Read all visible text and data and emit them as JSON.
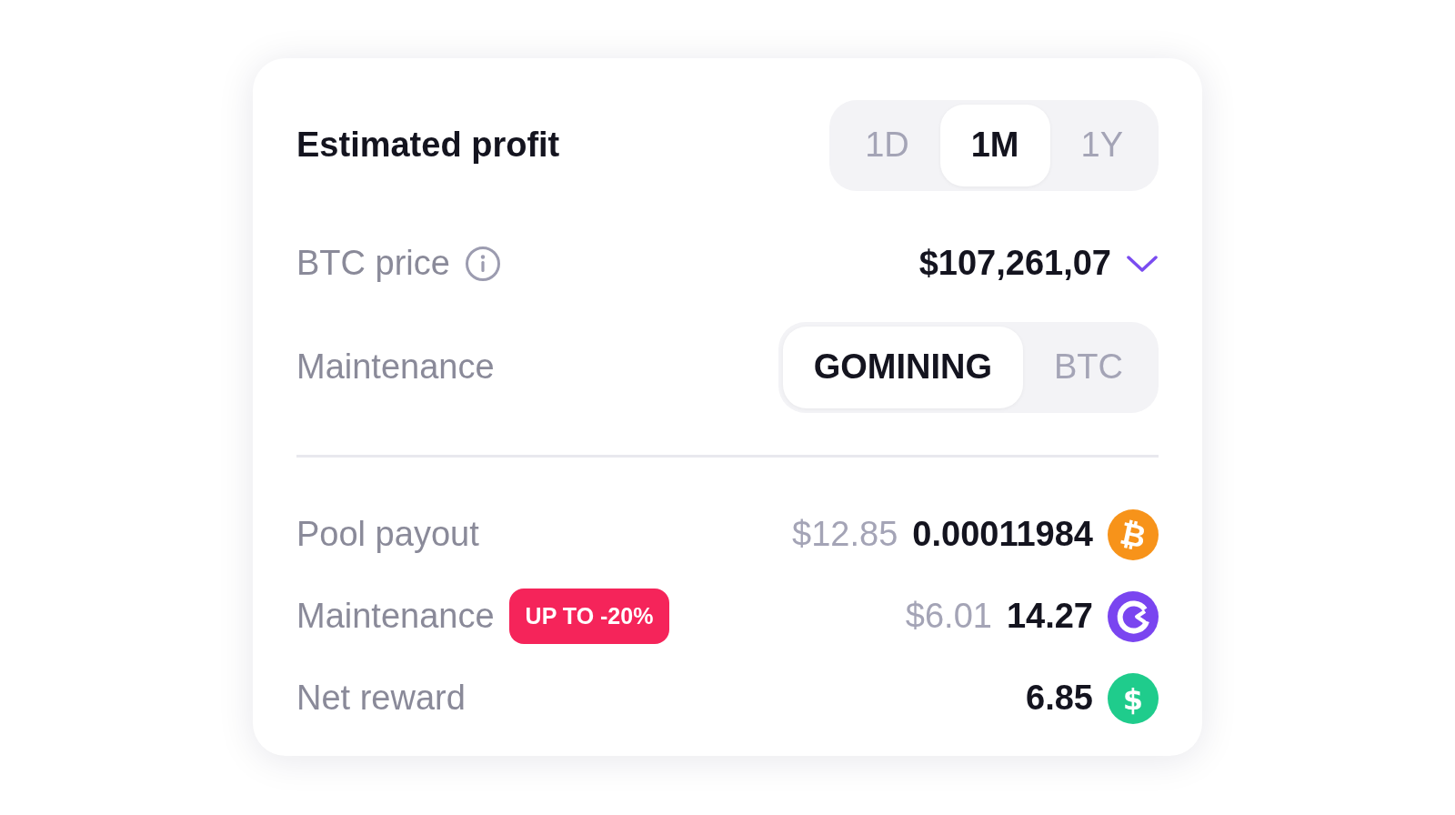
{
  "title": "Estimated profit",
  "periods": [
    {
      "label": "1D",
      "selected": false
    },
    {
      "label": "1M",
      "selected": true
    },
    {
      "label": "1Y",
      "selected": false
    }
  ],
  "btc_price": {
    "label": "BTC price",
    "value": "$107,261,07"
  },
  "maintenance_mode": {
    "label": "Maintenance",
    "options": [
      {
        "label": "GOMINING",
        "selected": true
      },
      {
        "label": "BTC",
        "selected": false
      }
    ]
  },
  "rows": [
    {
      "label": "Pool payout",
      "usd": "$12.85",
      "amount": "0.00011984",
      "kind": "btc",
      "symbol": "₿"
    },
    {
      "label": "Maintenance",
      "badge": "UP TO -20%",
      "usd": "$6.01",
      "amount": "14.27",
      "kind": "gomining"
    },
    {
      "label": "Net reward",
      "amount": "6.85",
      "kind": "usd",
      "symbol": "$"
    }
  ]
}
